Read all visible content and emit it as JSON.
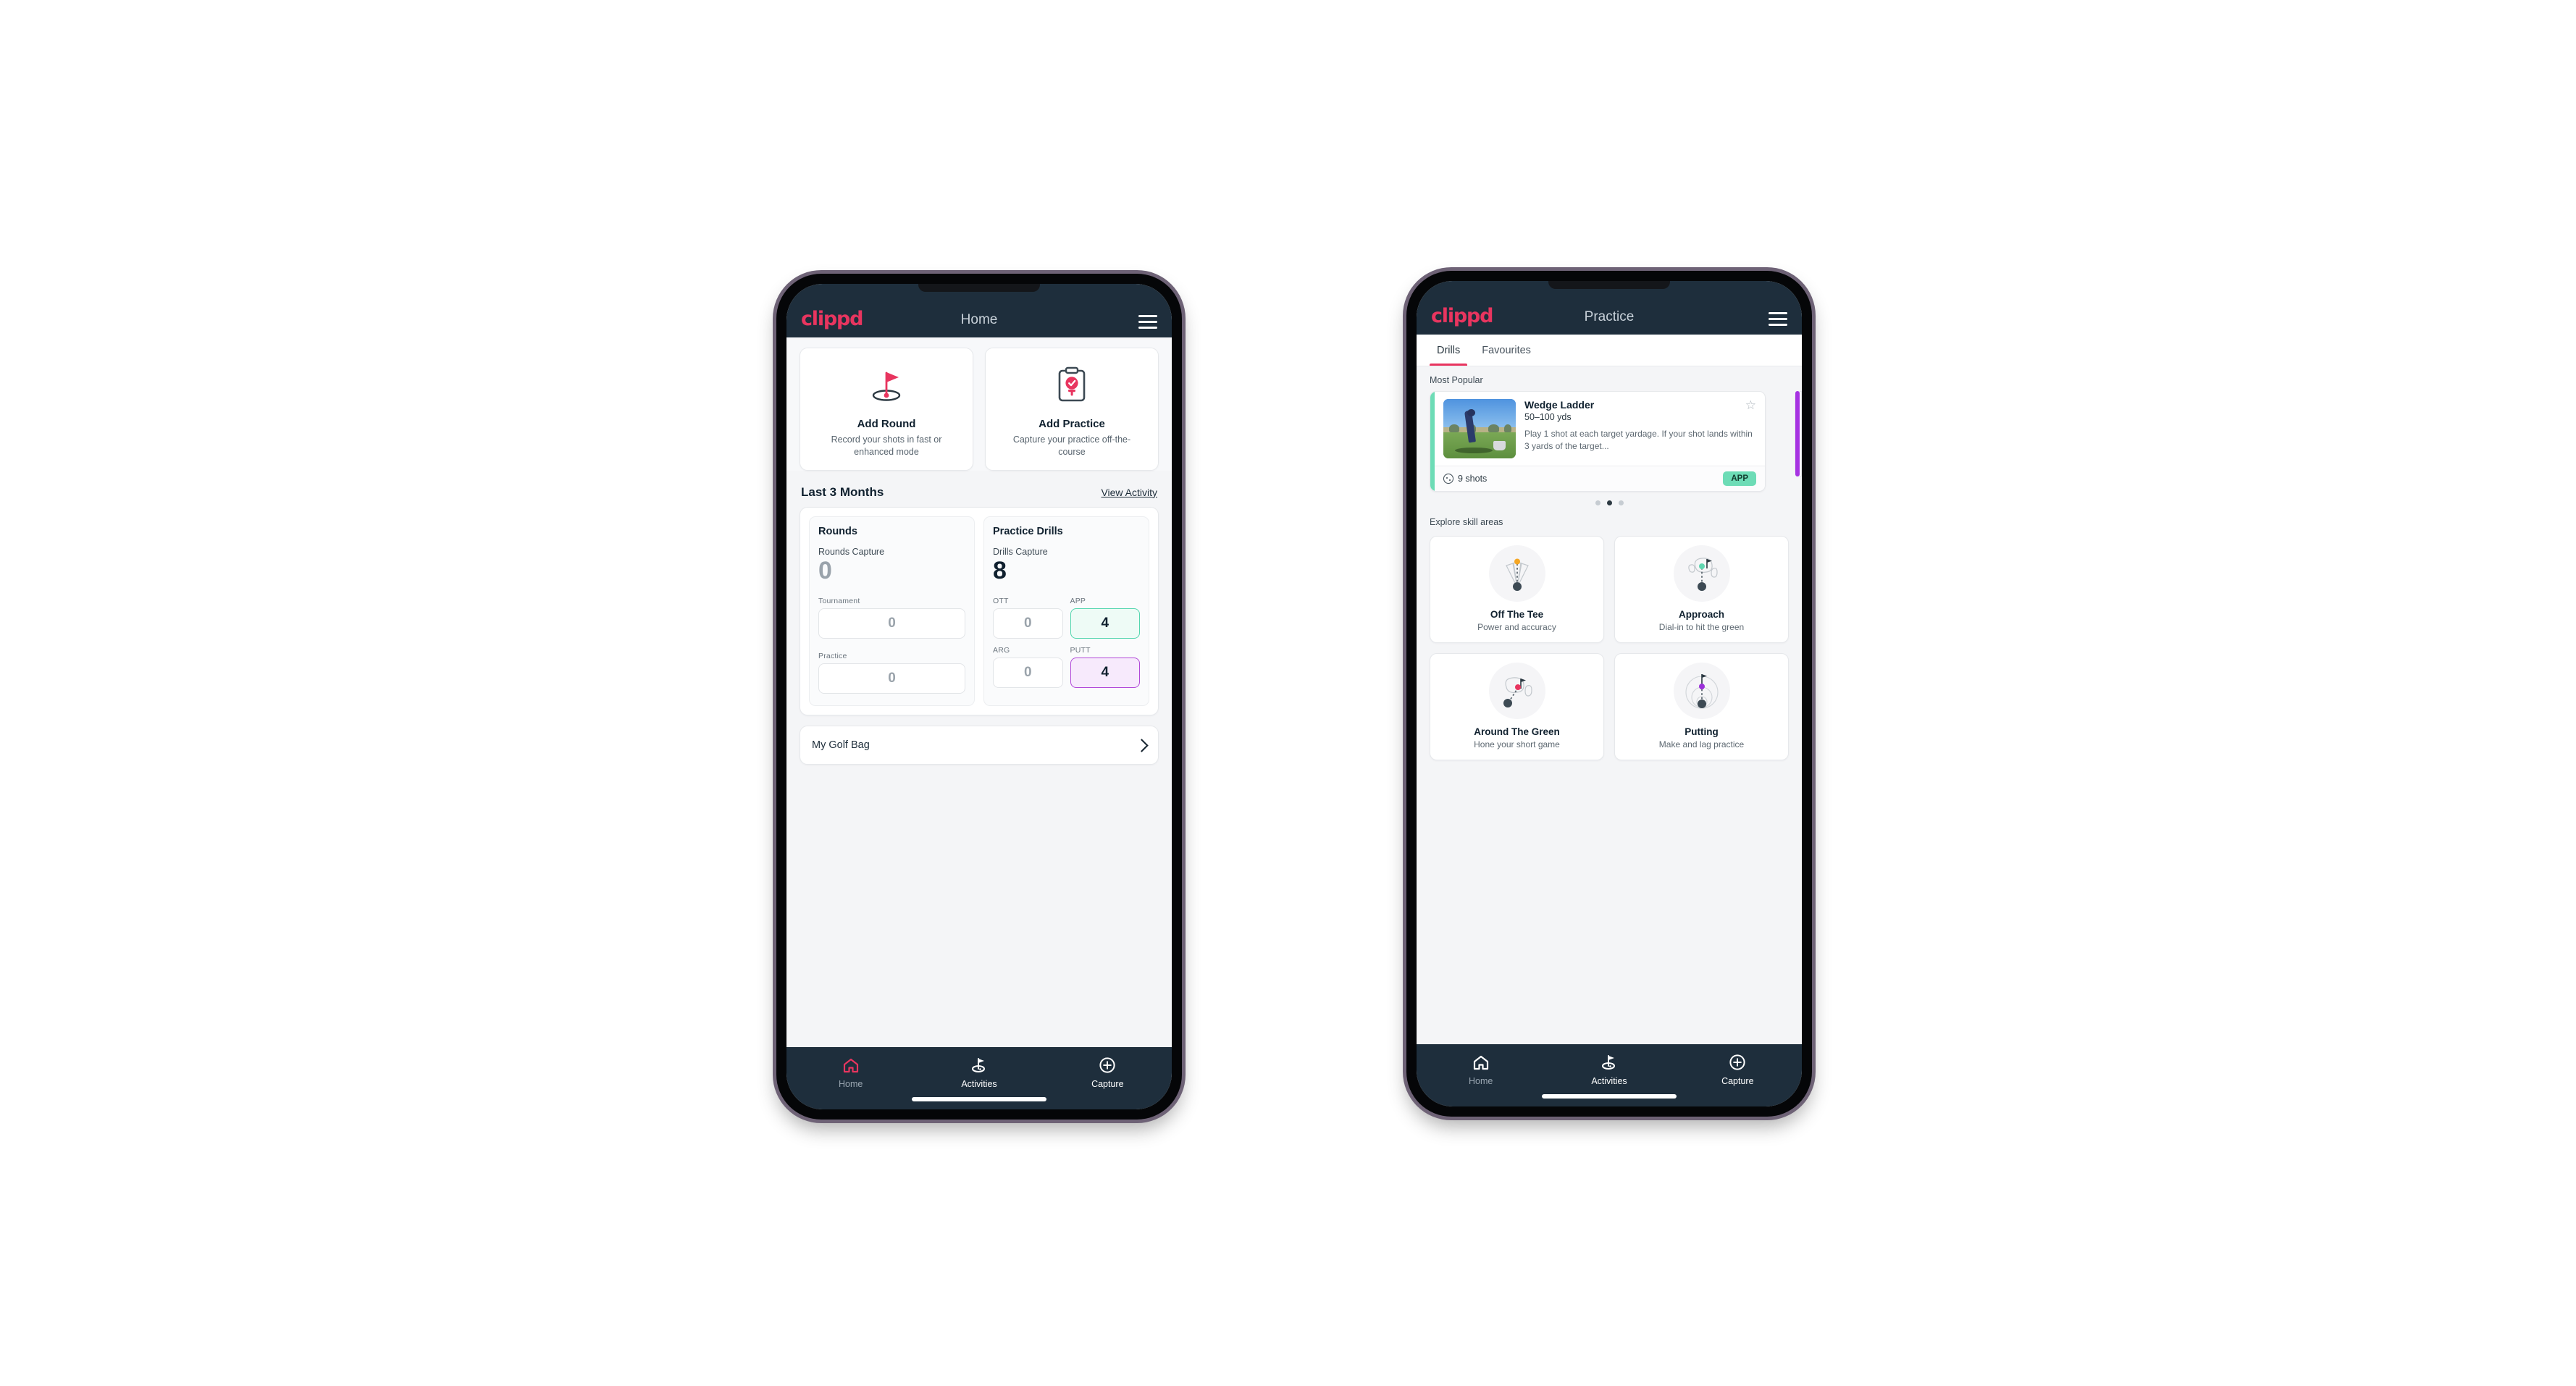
{
  "brand": {
    "wordmark": "clippd",
    "accent_pink": "#e8355f",
    "nav_dark": "#1e2e3c",
    "teal": "#6ddcb6",
    "purple": "#a633e2"
  },
  "home": {
    "appbar": {
      "title": "Home",
      "menu_icon": "hamburger-icon"
    },
    "actions": [
      {
        "icon": "golf-flag-hole-icon",
        "title": "Add Round",
        "subtitle": "Record your shots in fast or enhanced mode"
      },
      {
        "icon": "clipboard-check-icon",
        "title": "Add Practice",
        "subtitle": "Capture your practice off-the-course"
      }
    ],
    "section": {
      "title": "Last 3 Months",
      "link": "View Activity"
    },
    "rounds": {
      "heading": "Rounds",
      "capture_label": "Rounds Capture",
      "capture_value": "0",
      "fields": [
        {
          "label": "Tournament",
          "value": "0",
          "style": "plain"
        },
        {
          "label": "Practice",
          "value": "0",
          "style": "plain"
        }
      ]
    },
    "drills": {
      "heading": "Practice Drills",
      "capture_label": "Drills Capture",
      "capture_value": "8",
      "fields": [
        {
          "label": "OTT",
          "value": "0",
          "style": "plain"
        },
        {
          "label": "APP",
          "value": "4",
          "style": "app"
        },
        {
          "label": "ARG",
          "value": "0",
          "style": "plain"
        },
        {
          "label": "PUTT",
          "value": "4",
          "style": "putt"
        }
      ]
    },
    "golf_bag": {
      "label": "My Golf Bag",
      "chevron": "chevron-right-icon"
    },
    "bottom_nav": [
      {
        "icon": "home-icon",
        "label": "Home",
        "active": true
      },
      {
        "icon": "golf-flag-icon",
        "label": "Activities",
        "active": false
      },
      {
        "icon": "plus-circle-icon",
        "label": "Capture",
        "active": false
      }
    ]
  },
  "practice": {
    "appbar": {
      "title": "Practice",
      "menu_icon": "hamburger-icon"
    },
    "tabs": [
      {
        "label": "Drills",
        "active": true
      },
      {
        "label": "Favourites",
        "active": false
      }
    ],
    "most_popular_label": "Most Popular",
    "drill": {
      "title": "Wedge Ladder",
      "distance": "50–100 yds",
      "description": "Play 1 shot at each target yardage. If your shot lands within 3 yards of the target...",
      "shots": "9 shots",
      "shots_icon": "golf-ball-icon",
      "tag": "APP",
      "tag_color": "#6ddcb6",
      "favourite_icon": "star-outline-icon",
      "thumbnail": "golfer-wedge-shot-photo",
      "accent_color": "#6ddcb6"
    },
    "carousel_dots": {
      "count": 3,
      "active_index": 1
    },
    "skill_label": "Explore skill areas",
    "skills": [
      {
        "icon": "tee-dispersion-icon",
        "name": "Off The Tee",
        "sub": "Power and accuracy",
        "dot_color": "#f5a623"
      },
      {
        "icon": "approach-green-icon",
        "name": "Approach",
        "sub": "Dial-in to hit the green",
        "dot_color": "#5fd6b0"
      },
      {
        "icon": "chip-green-icon",
        "name": "Around The Green",
        "sub": "Hone your short game",
        "dot_color": "#e8355f"
      },
      {
        "icon": "putting-rings-icon",
        "name": "Putting",
        "sub": "Make and lag practice",
        "dot_color": "#9b30d9"
      }
    ],
    "bottom_nav": [
      {
        "icon": "home-icon",
        "label": "Home",
        "active": false
      },
      {
        "icon": "golf-flag-icon",
        "label": "Activities",
        "active": true
      },
      {
        "icon": "plus-circle-icon",
        "label": "Capture",
        "active": false
      }
    ]
  }
}
